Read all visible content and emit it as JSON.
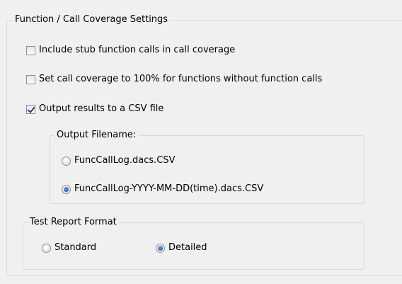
{
  "coverage_group": {
    "title": "Function / Call Coverage Settings",
    "options": [
      {
        "label": "Include stub function calls in call coverage",
        "checked": false
      },
      {
        "label": "Set call coverage to 100% for functions without function calls",
        "checked": false
      },
      {
        "label": "Output results to a CSV file",
        "checked": true
      }
    ],
    "output_filename": {
      "title": "Output Filename:",
      "options": [
        {
          "label": "FuncCallLog.dacs.CSV",
          "selected": false
        },
        {
          "label": "FuncCallLog-YYYY-MM-DD(time).dacs.CSV",
          "selected": true
        }
      ]
    }
  },
  "report_format_group": {
    "title": "Test Report Format",
    "options": [
      {
        "label": "Standard",
        "selected": false
      },
      {
        "label": "Detailed",
        "selected": true
      }
    ]
  }
}
